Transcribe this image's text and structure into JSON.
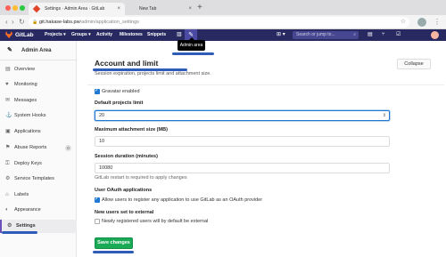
{
  "browser": {
    "tabs": [
      {
        "title": "Settings · Admin Area · GitLab",
        "close": "×"
      },
      {
        "title": "New Tab",
        "close": "×"
      }
    ],
    "new_tab": "+",
    "nav": {
      "back": "‹",
      "forward": "›",
      "reload": "↻"
    },
    "url_host": "git.hakase-labs.pw",
    "url_path": "/admin/application_settings",
    "lock": "🔒",
    "star": "☆",
    "menu": "⋮"
  },
  "gitlab_nav": {
    "brand": "GitLab",
    "items": [
      "Projects ▾",
      "Groups ▾",
      "Activity",
      "Milestones",
      "Snippets"
    ],
    "search_placeholder": "Search or jump to...",
    "tooltip": "Admin area",
    "plus": "⊞ ▾",
    "icons": [
      "graph-icon",
      "wrench-icon",
      "plus-icon",
      "issues-icon",
      "merge-request-icon",
      "todos-icon"
    ]
  },
  "sidebar": {
    "header": "Admin Area",
    "items": [
      {
        "label": "Overview",
        "icon": "▤"
      },
      {
        "label": "Monitoring",
        "icon": "♥"
      },
      {
        "label": "Messages",
        "icon": "✉"
      },
      {
        "label": "System Hooks",
        "icon": "⚓"
      },
      {
        "label": "Applications",
        "icon": "▣"
      },
      {
        "label": "Abuse Reports",
        "icon": "⚑",
        "badge": "0"
      },
      {
        "label": "Deploy Keys",
        "icon": "⚿"
      },
      {
        "label": "Service Templates",
        "icon": "⚙"
      },
      {
        "label": "Labels",
        "icon": "⌂"
      },
      {
        "label": "Appearance",
        "icon": "◐"
      },
      {
        "label": "Settings",
        "icon": "⚙"
      }
    ]
  },
  "section": {
    "title": "Account and limit",
    "subtitle": "Session expiration, projects limit and attachment size.",
    "collapse": "Collapse",
    "gravatar_label": "Gravatar enabled",
    "default_projects_limit_label": "Default projects limit",
    "default_projects_limit_value": "20",
    "max_attachment_label": "Maximum attachment size (MB)",
    "max_attachment_value": "10",
    "session_duration_label": "Session duration (minutes)",
    "session_duration_value": "10080",
    "session_help": "GitLab restart is required to apply changes",
    "user_oauth_label": "User OAuth applications",
    "user_oauth_option": "Allow users to register any application to use GitLab as an OAuth provider",
    "new_users_label": "New users set to external",
    "new_users_option": "Newly registered users will by default be external",
    "save": "Save changes",
    "spin": "⇕"
  }
}
